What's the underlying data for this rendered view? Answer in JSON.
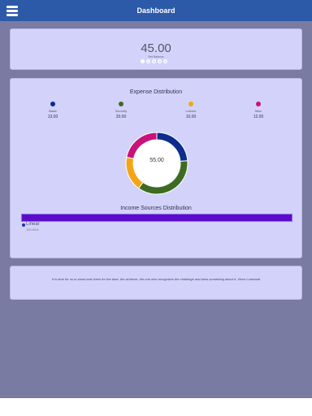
{
  "header": {
    "title": "Dashboard",
    "menu_icon": "hamburger-menu-icon"
  },
  "balance": {
    "amount": "45.00",
    "label": "Net Balance",
    "pages": 5,
    "active_page": 1
  },
  "expense": {
    "title": "Expense Distribution",
    "categories": [
      {
        "name": "Basic",
        "value": "13.00",
        "color": "#0d2d8c"
      },
      {
        "name": "Security",
        "value": "20.00",
        "color": "#3d6b22"
      },
      {
        "name": "Leisure",
        "value": "10.00",
        "color": "#f5a513"
      },
      {
        "name": "Misc",
        "value": "12.00",
        "color": "#c8127a"
      }
    ],
    "total": "55.00"
  },
  "income": {
    "title": "Income Sources Distribution",
    "bar_color": "#5b0cc9",
    "legend": [
      {
        "name": "Linear",
        "percent": "100.00%",
        "fraction": 1.0
      }
    ]
  },
  "quote": {
    "text": "It is time for us to stand and cheer for the doer, the achiever, the one who recognizes the challenge and does something about it. Vince Lombardi"
  },
  "chart_data": [
    {
      "type": "pie",
      "title": "Expense Distribution",
      "categories": [
        "Basic",
        "Security",
        "Leisure",
        "Misc"
      ],
      "values": [
        13.0,
        20.0,
        10.0,
        12.0
      ],
      "colors": [
        "#0d2d8c",
        "#3d6b22",
        "#f5a513",
        "#c8127a"
      ],
      "center_label": "55.00",
      "legend": "top"
    },
    {
      "type": "bar",
      "title": "Income Sources Distribution",
      "categories": [
        "Linear"
      ],
      "values": [
        100.0
      ],
      "legend": "bottom-left"
    }
  ]
}
